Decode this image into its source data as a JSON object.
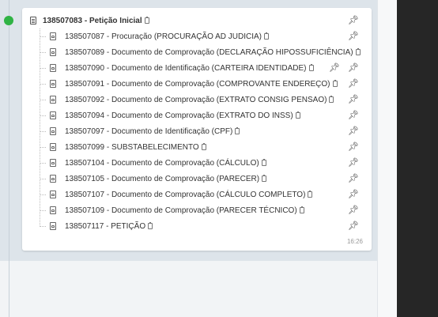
{
  "root": {
    "label": "138507083 - Petição Inicial"
  },
  "items": [
    {
      "label": "138507087 - Procuração (PROCURAÇÃO AD JUDICIA)",
      "pins": 1
    },
    {
      "label": "138507089 - Documento de Comprovação (DECLARAÇÃO HIPOSSUFICIÊNCIA)",
      "pins": 0
    },
    {
      "label": "138507090 - Documento de Identificação (CARTEIRA IDENTIDADE)",
      "pins": 2
    },
    {
      "label": "138507091 - Documento de Comprovação (COMPROVANTE ENDEREÇO)",
      "pins": 1
    },
    {
      "label": "138507092 - Documento de Comprovação (EXTRATO CONSIG PENSAO)",
      "pins": 1
    },
    {
      "label": "138507094 - Documento de Comprovação (EXTRATO DO INSS)",
      "pins": 1
    },
    {
      "label": "138507097 - Documento de Identificação (CPF)",
      "pins": 1
    },
    {
      "label": "138507099 - SUBSTABELECIMENTO",
      "pins": 1
    },
    {
      "label": "138507104 - Documento de Comprovação (CÁLCULO)",
      "pins": 1
    },
    {
      "label": "138507105 - Documento de Comprovação (PARECER)",
      "pins": 1
    },
    {
      "label": "138507107 - Documento de Comprovação (CÁLCULO COMPLETO)",
      "pins": 1
    },
    {
      "label": "138507109 - Documento de Comprovação (PARECER TÉCNICO)",
      "pins": 1
    },
    {
      "label": "138507117 - PETIÇÃO",
      "pins": 1
    }
  ],
  "timestamp": "16:26",
  "colors": {
    "status_dot": "#2fb344",
    "background": "#dde4ea",
    "dark_panel": "#262626"
  },
  "icons": {
    "root": "document-icon",
    "item": "pdf-file-icon",
    "attachment": "clipboard-icon",
    "pin": "pushpin-icon"
  }
}
